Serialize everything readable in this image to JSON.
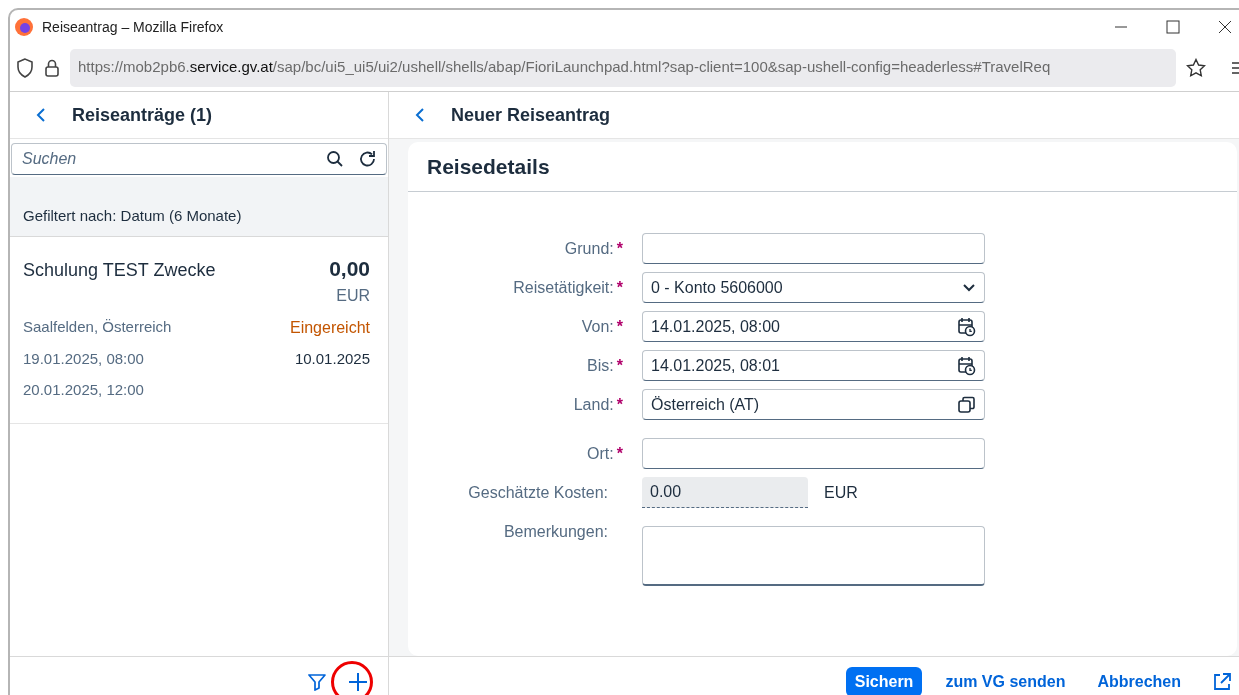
{
  "window": {
    "title": "Reiseantrag – Mozilla Firefox"
  },
  "address_bar": {
    "url_prefix": "https://mob2pb6.",
    "url_domain": "service.gv.at",
    "url_rest": "/sap/bc/ui5_ui5/ui2/ushell/shells/abap/FioriLaunchpad.html?sap-client=100&sap-ushell-config=headerless#TravelReq"
  },
  "master": {
    "title": "Reiseanträge (1)",
    "search": {
      "placeholder": "Suchen"
    },
    "filter_info": "Gefiltert nach: Datum (6 Monate)",
    "items": [
      {
        "title": "Schulung TEST Zwecke",
        "amount": "0,00",
        "currency": "EUR",
        "location": "Saalfelden, Österreich",
        "status": "Eingereicht",
        "color": "#c35500",
        "start": "19.01.2025, 08:00",
        "date": "10.01.2025",
        "end": "20.01.2025, 12:00",
        "selected": false
      }
    ],
    "add_highlighted": true
  },
  "detail": {
    "title": "Neuer Reiseantrag",
    "section_title": "Reisedetails",
    "fields": [
      {
        "kind": "text",
        "label": "Grund:",
        "required_mark": "*"
      },
      {
        "kind": "select",
        "label": "Reisetätigkeit:",
        "required_mark": "*",
        "value": "0  - Konto 5606000"
      },
      {
        "kind": "datetime",
        "label": "Von:",
        "required_mark": "*",
        "value": "14.01.2025, 08:00"
      },
      {
        "kind": "datetime",
        "label": "Bis:",
        "required_mark": "*",
        "value": "14.01.2025, 08:01"
      },
      {
        "kind": "valuehelp",
        "label": "Land:",
        "required_mark": "*",
        "value": "Österreich (AT)"
      },
      {
        "kind": "text",
        "label": "Ort:",
        "required_mark": "*"
      },
      {
        "kind": "readonly",
        "label": "Geschätzte Kosten:",
        "value": "0.00",
        "unit": "EUR"
      },
      {
        "kind": "textarea",
        "label": "Bemerkungen:"
      }
    ],
    "buttons": [
      {
        "kind": "emphasized",
        "label": "Sichern"
      },
      {
        "kind": "transparent",
        "label": "zum VG senden"
      },
      {
        "kind": "transparent",
        "label": "Abbrechen"
      }
    ]
  }
}
